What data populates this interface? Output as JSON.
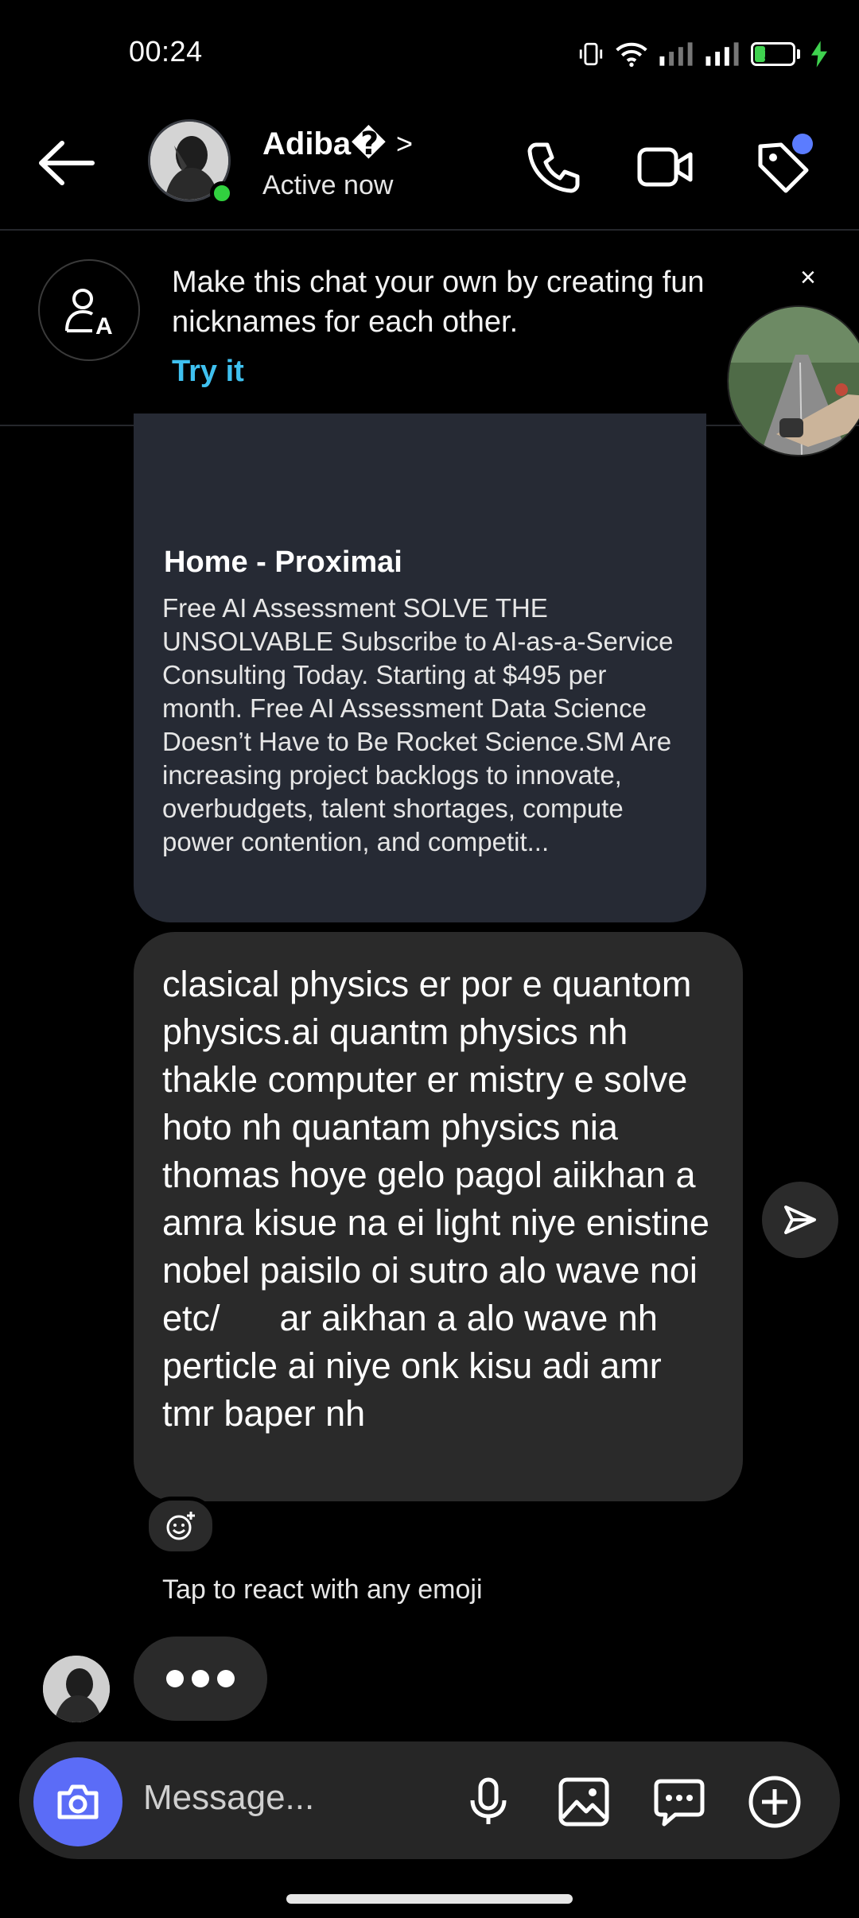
{
  "status_bar": {
    "time": "00:24",
    "battery": "29",
    "battery_fraction": 0.29
  },
  "header": {
    "name": "Adiba�",
    "chevron": ">",
    "status": "Active now"
  },
  "nickname_banner": {
    "text": "Make this chat your own by creating fun nicknames for each other.",
    "action": "Try it",
    "close": "×"
  },
  "link_preview": {
    "title": "Home - Proximai",
    "description": "Free AI Assessment SOLVE THE UNSOLVABLE Subscribe to AI-as-a-Service Consulting Today. Starting at $495 per month. Free AI Assessment Data Science Doesn’t Have to Be Rocket Science.SM Are increasing project backlogs to innovate, overbudgets, talent shortages, compute power contention, and competit..."
  },
  "message": {
    "text": "clasical physics er por e quantom physics.ai quantm physics nh thakle computer er mistry e solve hoto nh quantam physics nia thomas hoye gelo pagol aiikhan a amra kisue na ei light niye enistine nobel paisilo oi sutro alo wave noi etc/      ar aikhan a alo wave nh perticle ai niye onk kisu adi amr tmr baper nh"
  },
  "reaction_hint": "Tap to react with any emoji",
  "composer": {
    "placeholder": "Message..."
  },
  "colors": {
    "accent_blue": "#5b6cf7",
    "link_blue": "#3fc1f0",
    "online_green": "#31d13f",
    "notification_dot": "#5b7cff"
  },
  "icons": [
    "back-arrow-icon",
    "phone-icon",
    "video-camera-icon",
    "tag-icon",
    "nickname-icon",
    "close-icon",
    "share-icon",
    "add-reaction-icon",
    "camera-icon",
    "microphone-icon",
    "gallery-icon",
    "sticker-chat-icon",
    "plus-icon"
  ]
}
